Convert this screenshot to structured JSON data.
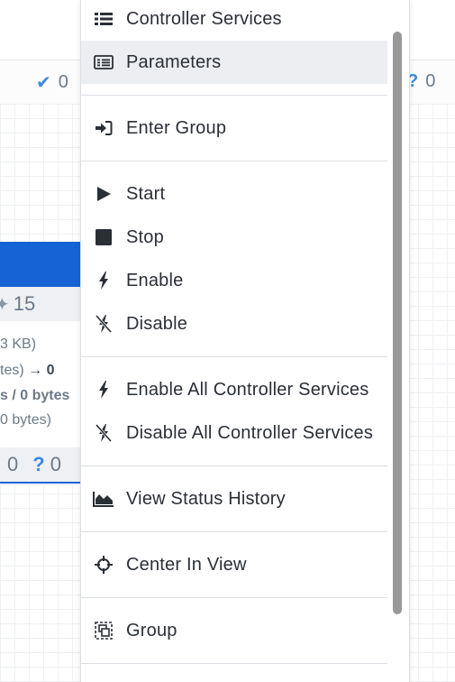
{
  "status_bar": {
    "valid_count": "0",
    "unknown_count": "0"
  },
  "process_group": {
    "disabled_count": "15",
    "line1": "3 KB)",
    "line2_prefix": "tes)",
    "line2_value": "0",
    "line3": "s / 0 bytes",
    "line4": "0 bytes)",
    "foot_count_a": "0",
    "foot_count_b": "0"
  },
  "menu": {
    "items": [
      {
        "label": "Controller Services",
        "icon": "list-icon"
      },
      {
        "label": "Parameters",
        "icon": "table-icon",
        "selected": true
      },
      {
        "label": "Enter Group",
        "icon": "sign-in-icon"
      },
      {
        "label": "Start",
        "icon": "play-icon"
      },
      {
        "label": "Stop",
        "icon": "stop-icon"
      },
      {
        "label": "Enable",
        "icon": "bolt-icon"
      },
      {
        "label": "Disable",
        "icon": "bolt-slash-icon"
      },
      {
        "label": "Enable All Controller Services",
        "icon": "bolt-icon"
      },
      {
        "label": "Disable All Controller Services",
        "icon": "bolt-slash-icon"
      },
      {
        "label": "View Status History",
        "icon": "area-chart-icon"
      },
      {
        "label": "Center In View",
        "icon": "crosshairs-icon"
      },
      {
        "label": "Group",
        "icon": "group-icon"
      }
    ]
  }
}
